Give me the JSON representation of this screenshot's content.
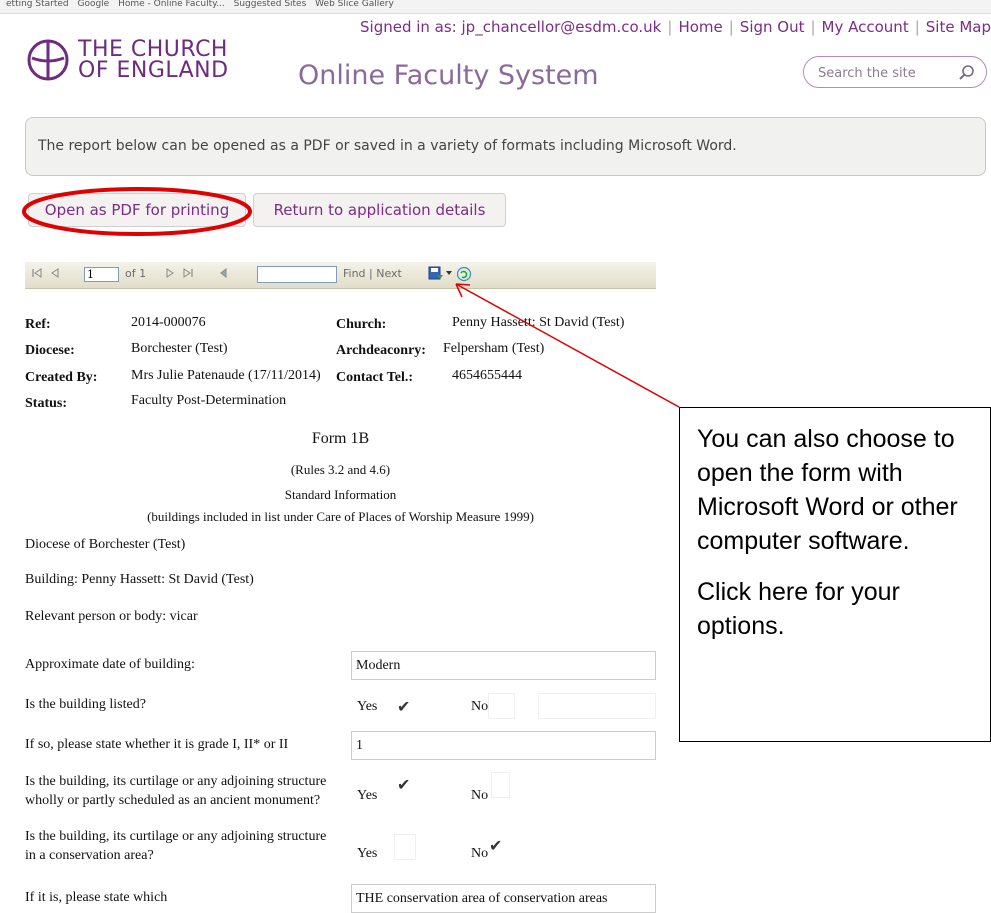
{
  "favorites_bar": [
    "etting Started",
    "Google",
    "Home - Online Faculty...",
    "Suggested Sites",
    "Web Slice Gallery"
  ],
  "top_nav": {
    "signed_in": "Signed in as: jp_chancellor@esdm.co.uk",
    "links": [
      "Home",
      "Sign Out",
      "My Account",
      "Site Map"
    ]
  },
  "logo": {
    "line1": "THE CHURCH",
    "line2": "OF ENGLAND"
  },
  "site_title": "Online Faculty System",
  "search": {
    "placeholder": "Search the site"
  },
  "info_text": "The report below can be opened as a PDF or saved in a variety of formats including Microsoft Word.",
  "buttons": {
    "open_pdf": "Open as PDF for printing",
    "return": "Return to application details"
  },
  "toolbar": {
    "page_value": "1",
    "of_label": "of 1",
    "find_next": "Find | Next"
  },
  "report": {
    "ref_label": "Ref:",
    "ref_value": "2014-000076",
    "diocese_label": "Diocese:",
    "diocese_value": "Borchester (Test)",
    "created_label": "Created By:",
    "created_value": "Mrs Julie Patenaude (17/11/2014)",
    "status_label": "Status:",
    "status_value": "Faculty Post-Determination",
    "church_label": "Church:",
    "church_value": "Penny Hassett: St David (Test)",
    "archdeaconry_label": "Archdeaconry:",
    "archdeaconry_value": "Felpersham (Test)",
    "contact_label": "Contact Tel.:",
    "contact_value": "4654655444",
    "form_title": "Form 1B",
    "rules": "(Rules 3.2 and 4.6)",
    "standard_info": "Standard Information",
    "buildings_note": "(buildings included in list under Care of Places of Worship Measure 1999)",
    "diocese_line": "Diocese of Borchester (Test)",
    "building_line": "Building: Penny Hassett: St David (Test)",
    "relevant_line": "Relevant person or body: vicar",
    "q_date": "Approximate date of building:",
    "a_date": "Modern",
    "q_listed": "Is the building listed?",
    "q_grade": "If so, please state whether it is grade I, II* or II",
    "a_grade": "1",
    "q_scheduled_1": "Is the building, its curtilage or any adjoining structure",
    "q_scheduled_2": "wholly or partly scheduled as an ancient monument?",
    "q_conservation_1": "Is the building, its curtilage or any adjoining structure",
    "q_conservation_2": "in a conservation area?",
    "q_which": "If it is, please state which",
    "a_which": "THE conservation area of conservation areas",
    "yes": "Yes",
    "no": "No",
    "check": "✔"
  },
  "callout": {
    "para1": "You can also choose to open the form with Microsoft Word or other computer software.",
    "para2": "Click here for your options."
  },
  "colors": {
    "brand_purple": "#7b2c86",
    "highlight_red": "#e00000"
  }
}
